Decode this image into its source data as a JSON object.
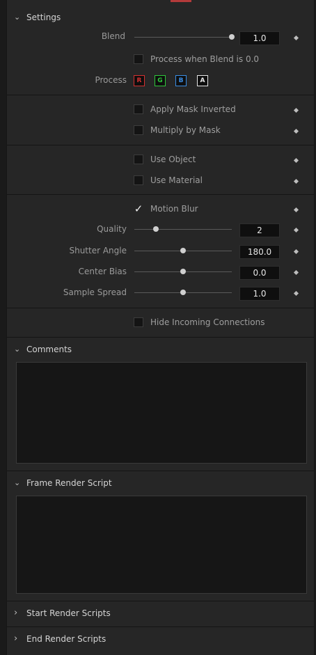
{
  "sections": {
    "settings": {
      "title": "Settings"
    },
    "comments": {
      "title": "Comments"
    },
    "frame_render": {
      "title": "Frame Render Script"
    },
    "start_render": {
      "title": "Start Render Scripts"
    },
    "end_render": {
      "title": "End Render Scripts"
    }
  },
  "blend": {
    "label": "Blend",
    "value": "1.0",
    "level": 1.0
  },
  "process_when_blend": {
    "label": "Process when Blend is 0.0",
    "checked": false
  },
  "process": {
    "label": "Process",
    "channels": [
      "R",
      "G",
      "B",
      "A"
    ],
    "colors": [
      "#d43030",
      "#2ec83a",
      "#3a8ee6",
      "#e6e6e6"
    ]
  },
  "apply_mask_inverted": {
    "label": "Apply Mask Inverted",
    "checked": false
  },
  "multiply_by_mask": {
    "label": "Multiply by Mask",
    "checked": false
  },
  "use_object": {
    "label": "Use Object",
    "checked": false
  },
  "use_material": {
    "label": "Use Material",
    "checked": false
  },
  "motion_blur": {
    "label": "Motion Blur",
    "checked": true
  },
  "quality": {
    "label": "Quality",
    "value": "2",
    "level": 0.22
  },
  "shutter_angle": {
    "label": "Shutter Angle",
    "value": "180.0",
    "level": 0.5
  },
  "center_bias": {
    "label": "Center Bias",
    "value": "0.0",
    "level": 0.5
  },
  "sample_spread": {
    "label": "Sample Spread",
    "value": "1.0",
    "level": 0.5
  },
  "hide_incoming": {
    "label": "Hide Incoming Connections",
    "checked": false
  },
  "icons": {
    "expanded": "chevron-down-icon",
    "collapsed": "chevron-right-icon",
    "keyframe": "diamond-icon"
  }
}
